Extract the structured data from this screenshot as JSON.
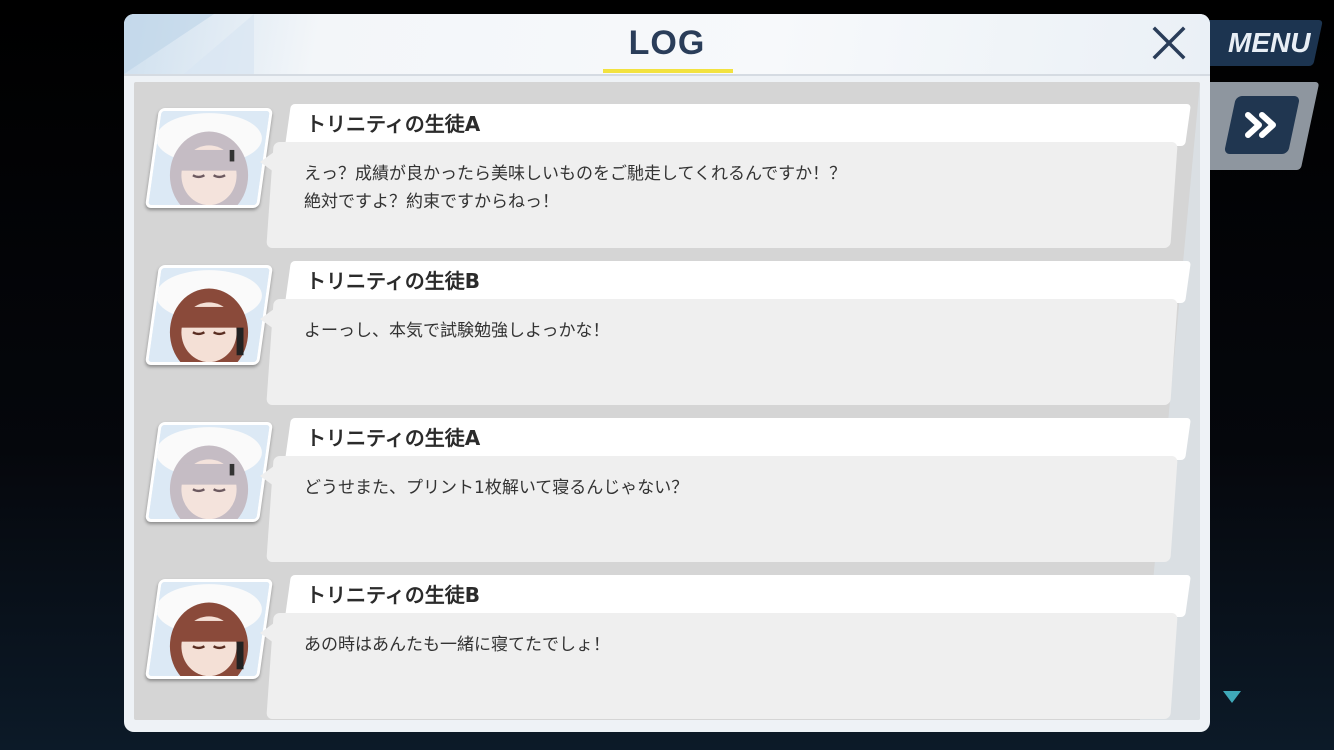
{
  "menu": {
    "label": "MENU",
    "icon": "fast-forward-icon"
  },
  "log": {
    "title": "LOG",
    "close_icon": "close-icon",
    "entries": [
      {
        "speaker": "トリニティの生徒A",
        "lines": [
          "えっ？成績が良かったら美味しいものをご馳走してくれるんですか！？",
          "絶対ですよ？約束ですからねっ！"
        ],
        "avatar": "silver"
      },
      {
        "speaker": "トリニティの生徒B",
        "lines": [
          "よーっし、本気で試験勉強しよっかな！",
          ""
        ],
        "avatar": "brown"
      },
      {
        "speaker": "トリニティの生徒A",
        "lines": [
          "どうせまた、プリント1枚解いて寝るんじゃない？",
          ""
        ],
        "avatar": "silver"
      },
      {
        "speaker": "トリニティの生徒B",
        "lines": [
          "あの時はあんたも一緒に寝てたでしょ！",
          ""
        ],
        "avatar": "brown"
      }
    ]
  },
  "colors": {
    "title": "#2a3d59",
    "underline": "#f2e240",
    "menu_bg": "#1c3450"
  }
}
